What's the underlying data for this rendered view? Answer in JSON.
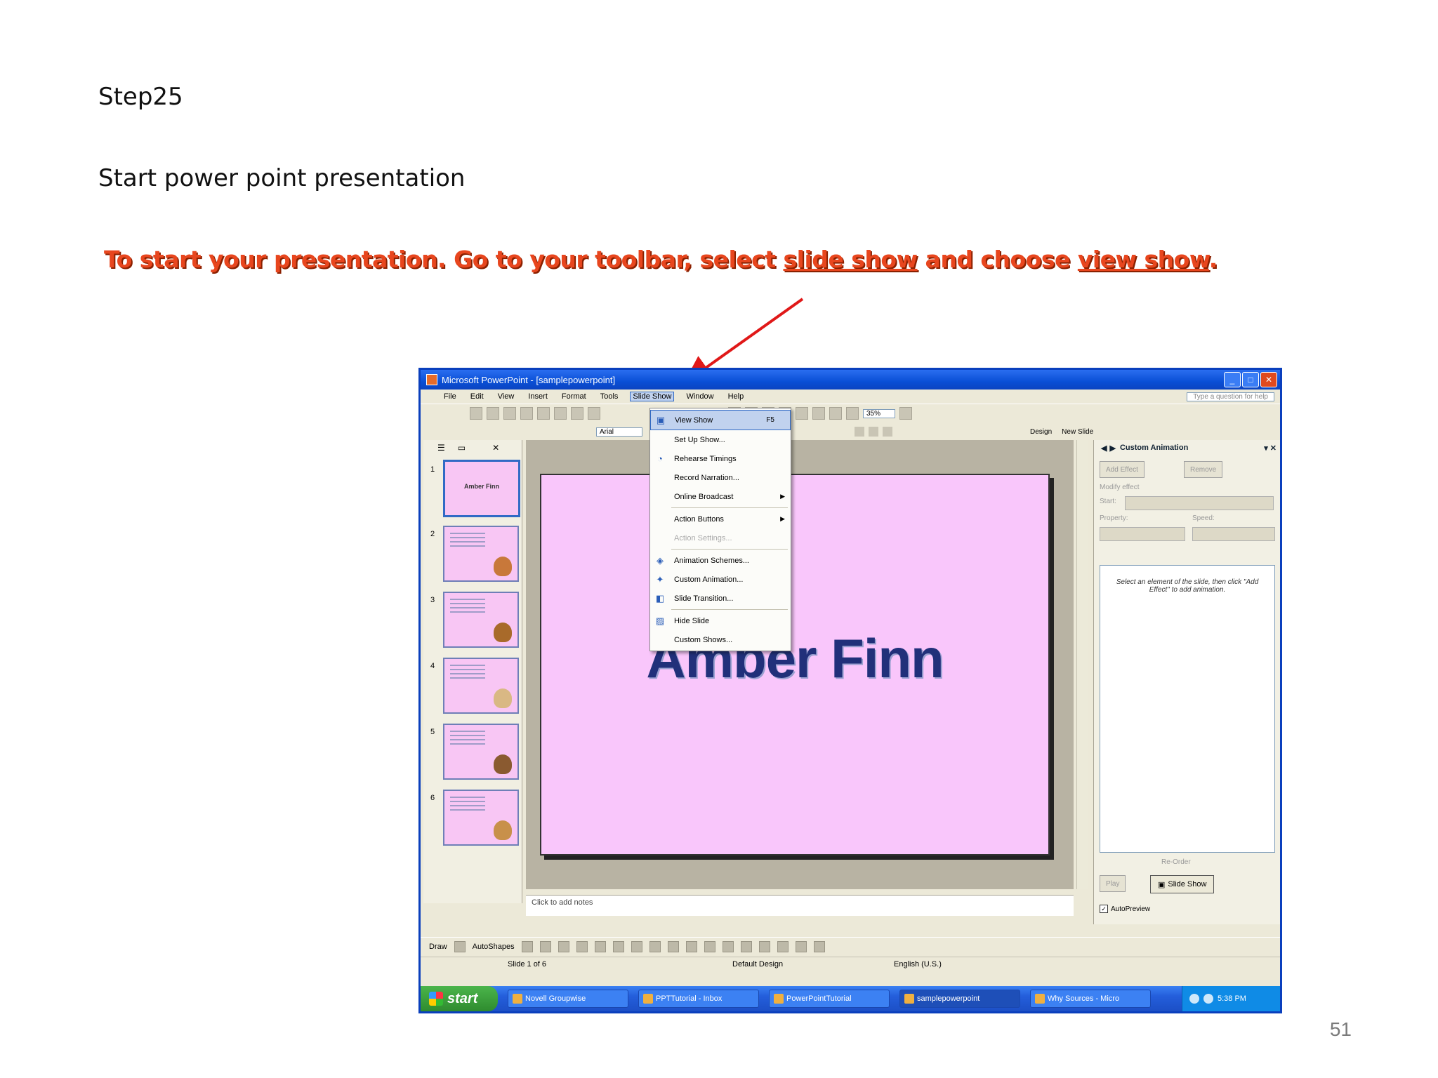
{
  "slide_text": {
    "step": "Step25",
    "subtitle": "Start power point presentation",
    "instruction_part1": "To start your presentation. Go to your toolbar, select ",
    "instruction_link1": "slide show",
    "instruction_part2": " and choose ",
    "instruction_link2": "view show",
    "instruction_end": ".",
    "page_number": "51"
  },
  "colors": {
    "instruction": "#e8461e",
    "arrow": "#e01818",
    "slide_bg": "#f9c6fb",
    "title_text": "#21307a"
  },
  "window": {
    "title": "Microsoft PowerPoint - [samplepowerpoint]",
    "menu": [
      "File",
      "Edit",
      "View",
      "Insert",
      "Format",
      "Tools",
      "Slide Show",
      "Window",
      "Help"
    ],
    "help_placeholder": "Type a question for help",
    "zoom": "35%",
    "font": "Arial",
    "design_label": "Design",
    "new_slide_label": "New Slide"
  },
  "dropdown": {
    "items": [
      {
        "label": "View Show",
        "shortcut": "F5",
        "icon": "projector-icon",
        "state": "highlighted"
      },
      {
        "label": "Set Up Show..."
      },
      {
        "label": "Rehearse Timings",
        "icon": "stopwatch-icon"
      },
      {
        "label": "Record Narration..."
      },
      {
        "label": "Online Broadcast",
        "submenu": true
      },
      {
        "label": "Action Buttons",
        "submenu": true
      },
      {
        "label": "Action Settings...",
        "state": "disabled"
      },
      {
        "label": "Animation Schemes...",
        "icon": "animation-icon"
      },
      {
        "label": "Custom Animation...",
        "icon": "star-icon"
      },
      {
        "label": "Slide Transition...",
        "icon": "transition-icon"
      },
      {
        "label": "Hide Slide",
        "icon": "hide-icon"
      },
      {
        "label": "Custom Shows..."
      }
    ]
  },
  "slides_pane": {
    "thumbnails": [
      "1",
      "2",
      "3",
      "4",
      "5",
      "6"
    ],
    "first_thumb_title": "Amber Finn"
  },
  "slide": {
    "title": "Amber Finn",
    "notes_placeholder": "Click to add notes"
  },
  "task_pane": {
    "title": "Custom Animation",
    "add_effect": "Add Effect",
    "remove": "Remove",
    "modify_label": "Modify effect",
    "start_label": "Start:",
    "property_label": "Property:",
    "speed_label": "Speed:",
    "list_hint": "Select an element of the slide, then click \"Add Effect\" to add animation.",
    "reorder": "Re-Order",
    "play": "Play",
    "slide_show": "Slide Show",
    "autopreview": "AutoPreview"
  },
  "drawing_toolbar": {
    "draw": "Draw",
    "autoshapes": "AutoShapes"
  },
  "status_bar": {
    "slide_count": "Slide 1 of 6",
    "design": "Default Design",
    "language": "English (U.S.)"
  },
  "taskbar": {
    "start": "start",
    "tasks": [
      "Novell Groupwise",
      "PPTTutorial - Inbox",
      "PowerPointTutorial",
      "samplepowerpoint",
      "Why Sources - Micro"
    ],
    "clock": "5:38 PM"
  }
}
